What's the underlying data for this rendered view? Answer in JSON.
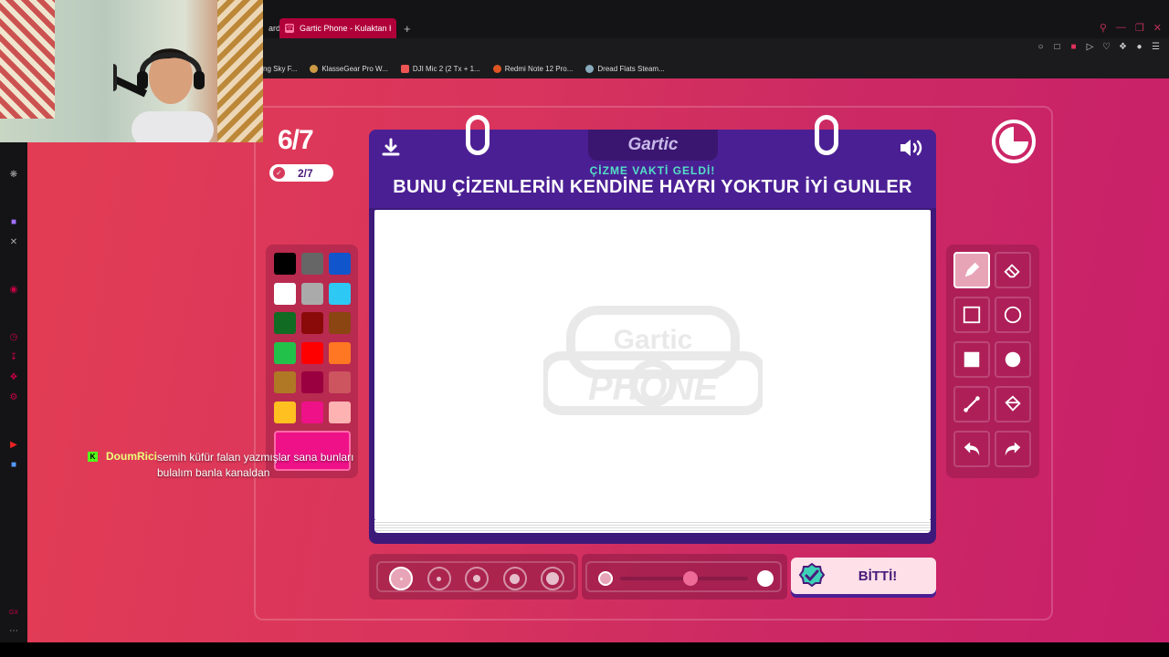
{
  "browser": {
    "prev_tab_fragment": "ard",
    "active_tab_title": "Gartic Phone - Kulaktan K",
    "new_tab_symbol": "+",
    "bookmarks": [
      {
        "label": "ng Sky F...",
        "icon": "bookmark-icon"
      },
      {
        "label": "KlasseGear Pro W...",
        "icon": "bookmark-icon"
      },
      {
        "label": "DJI Mic 2 (2 Tx + 1...",
        "icon": "bookmark-icon"
      },
      {
        "label": "Redmi Note 12 Pro...",
        "icon": "bookmark-icon"
      },
      {
        "label": "Dread Flats Steam...",
        "icon": "steam-icon"
      }
    ]
  },
  "game": {
    "round_label": "6/7",
    "done_count": "2/7",
    "logo_text": "Gartic",
    "subtitle": "ÇİZME VAKTİ GELDİ!",
    "prompt": "BUNU ÇİZENLERİN KENDİNE HAYRI YOKTUR İYİ GUNLER",
    "watermark_top": "Gartic",
    "watermark_bottom": "PHONE",
    "done_button": "BİTTİ!",
    "timer_remaining_fraction": 0.75,
    "opacity_level": 0.55,
    "selected_brush_size": 1,
    "selected_tool": "pencil",
    "colors": [
      "#000000",
      "#666666",
      "#1055cc",
      "#ffffff",
      "#aaaaaa",
      "#2ec8f5",
      "#116b22",
      "#8a0a0a",
      "#8a4512",
      "#22c24a",
      "#ff0000",
      "#ff7722",
      "#b07825",
      "#9a0040",
      "#cc5560",
      "#ffc020",
      "#ee1188",
      "#ffb2b2"
    ],
    "current_color": "#ee1188",
    "tools": [
      "pencil-icon",
      "eraser-icon",
      "rectangle-outline-icon",
      "circle-outline-icon",
      "rectangle-filled-icon",
      "circle-filled-icon",
      "line-icon",
      "bucket-icon",
      "undo-icon",
      "redo-icon"
    ]
  },
  "chat": {
    "username": "DoumRici",
    "message": "semih küfür falan yazmışlar sana bunları bulalım banla kanaldan"
  }
}
